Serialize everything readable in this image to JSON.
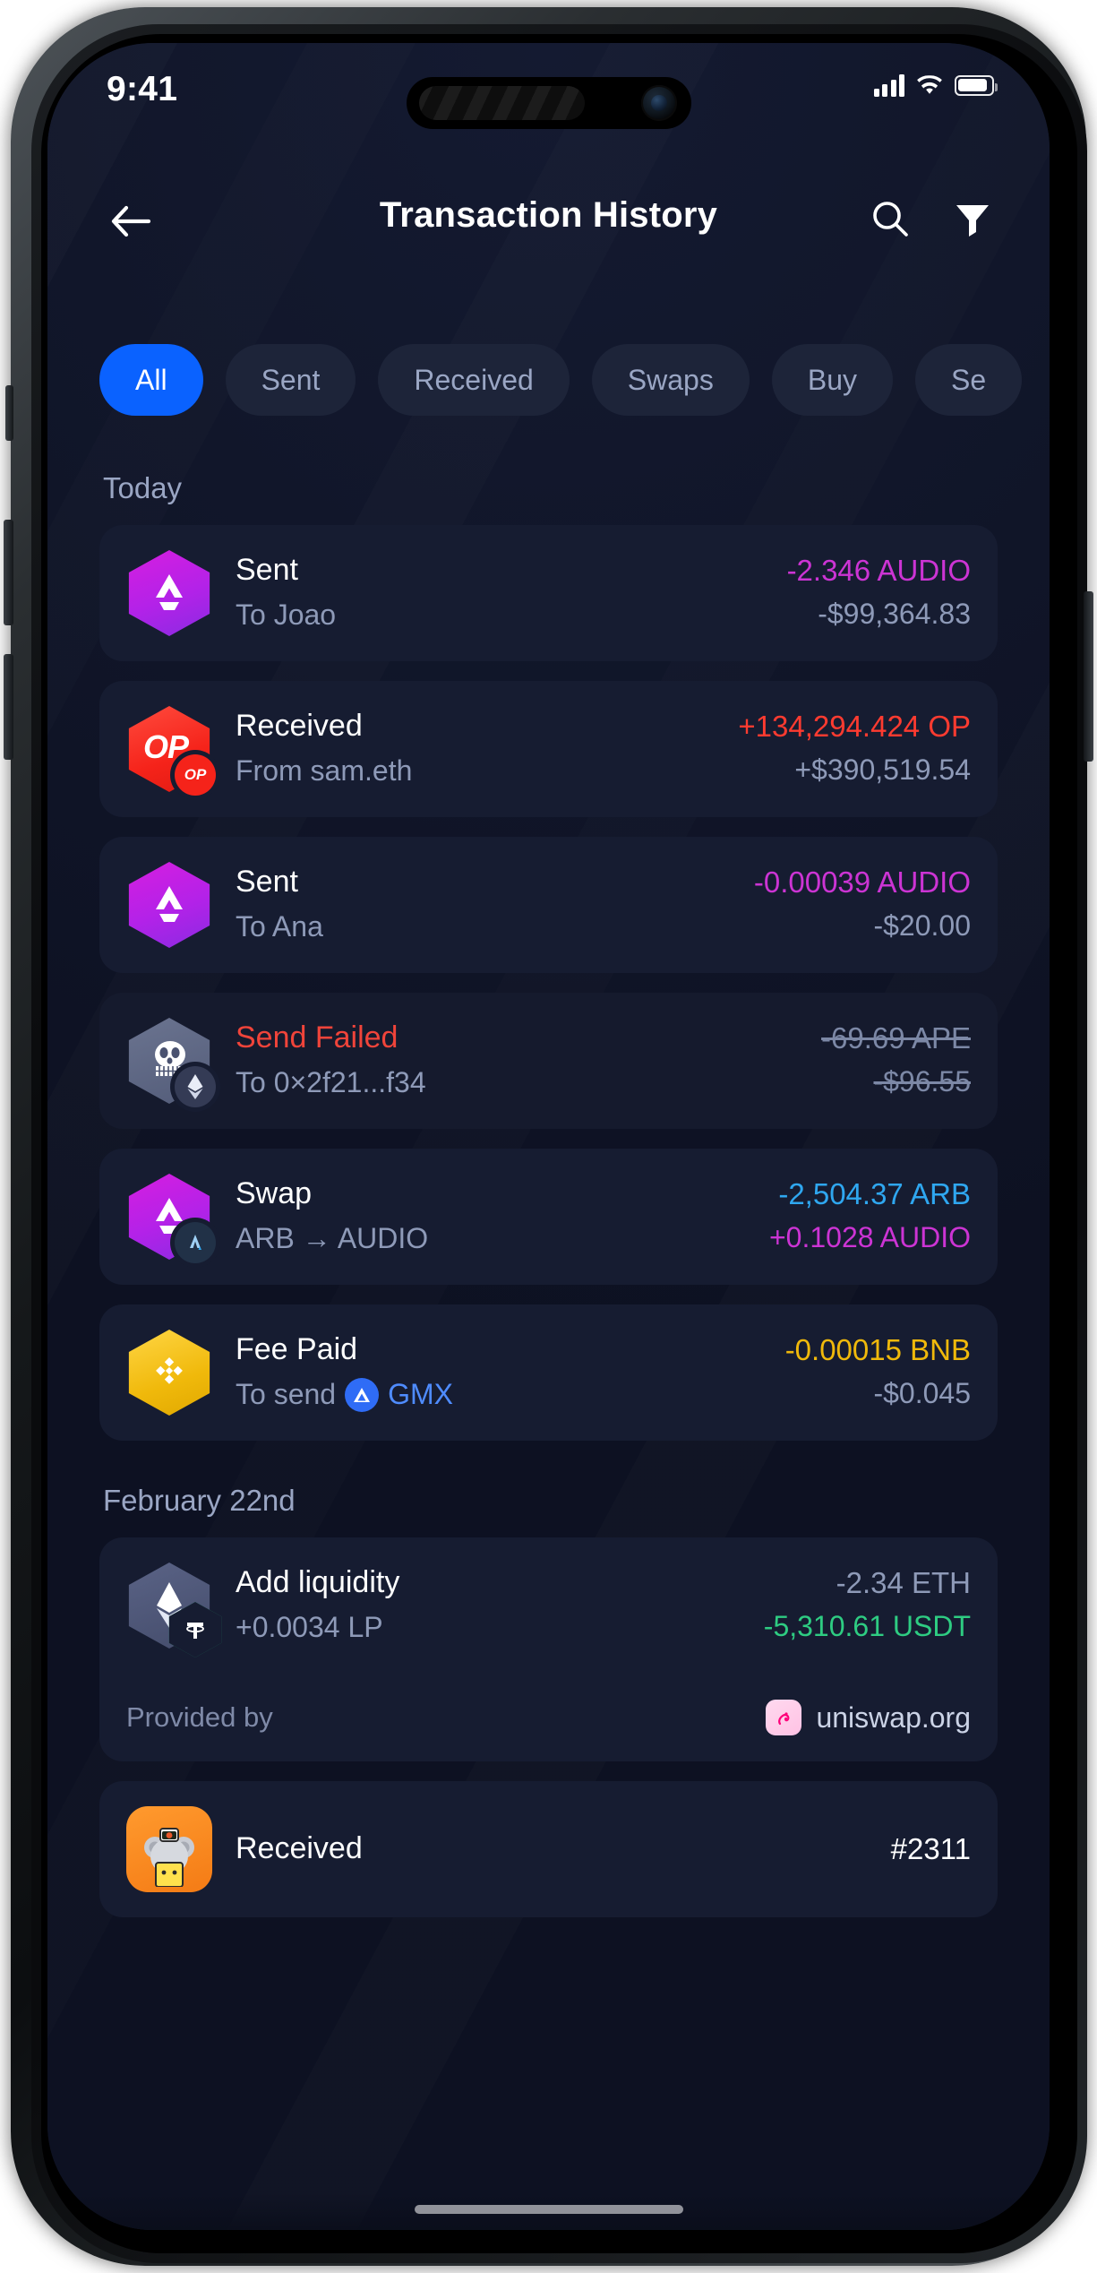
{
  "status_bar": {
    "time": "9:41",
    "icons": [
      "cellular-signal-icon",
      "wifi-icon",
      "battery-icon"
    ]
  },
  "header": {
    "back_icon": "arrow-left-icon",
    "title": "Transaction History",
    "search_icon": "search-icon",
    "filter_icon": "filter-funnel-icon"
  },
  "filters": {
    "active": "All",
    "chips": [
      {
        "label": "All",
        "active": true
      },
      {
        "label": "Sent",
        "active": false
      },
      {
        "label": "Received",
        "active": false
      },
      {
        "label": "Swaps",
        "active": false
      },
      {
        "label": "Buy",
        "active": false
      },
      {
        "label": "Se",
        "active": false
      }
    ]
  },
  "colors": {
    "accent_blue": "#0a62ff",
    "screen_bg": "#101528",
    "card_bg": "#161c31",
    "text_primary": "#ffffff",
    "text_secondary": "#8e9ab8",
    "error_red": "#f0443a",
    "audio_magenta": "#cc34d4",
    "op_red": "#ff3b30",
    "arb_blue": "#2fa7f0",
    "bnb_yellow": "#f0b90b",
    "eth_gray": "#8f9bb8",
    "usdt_green": "#26a17b",
    "link_blue": "#4f8cff"
  },
  "sections": [
    {
      "title": "Today",
      "items": [
        {
          "id": "tx-sent-audio-joao",
          "icon": "audio-token-icon",
          "title": "Sent",
          "title_color": "#ffffff",
          "subtitle": "To Joao",
          "amount": "-2.346 AUDIO",
          "amount_color": "#cc34d4",
          "fiat": "-$99,364.83",
          "fiat_color": "#8e9ab8",
          "failed": false
        },
        {
          "id": "tx-received-op-sam",
          "icon": "optimism-token-icon",
          "badge": "optimism-chain-badge",
          "title": "Received",
          "title_color": "#ffffff",
          "subtitle": "From sam.eth",
          "amount": "+134,294.424 OP",
          "amount_color": "#ff3b30",
          "fiat": "+$390,519.54",
          "fiat_color": "#8e9ab8",
          "failed": false
        },
        {
          "id": "tx-sent-audio-ana",
          "icon": "audio-token-icon",
          "title": "Sent",
          "title_color": "#ffffff",
          "subtitle": "To Ana",
          "amount": "-0.00039 AUDIO",
          "amount_color": "#cc34d4",
          "fiat": "-$20.00",
          "fiat_color": "#8e9ab8",
          "failed": false
        },
        {
          "id": "tx-send-failed-ape",
          "icon": "ape-token-icon",
          "badge": "ethereum-chain-badge",
          "title": "Send Failed",
          "title_color": "#f0443a",
          "subtitle": "To 0×2f21...f34",
          "amount": "-69.69 APE",
          "amount_color": "#7c88a6",
          "fiat": "-$96.55",
          "fiat_color": "#7c88a6",
          "failed": true
        },
        {
          "id": "tx-swap-arb-audio",
          "icon": "audio-token-icon",
          "badge": "arbitrum-chain-badge",
          "title": "Swap",
          "title_color": "#ffffff",
          "subtitle": "ARB → AUDIO",
          "amount": "-2,504.37 ARB",
          "amount_color": "#2fa7f0",
          "fiat": "+0.1028 AUDIO",
          "fiat_color": "#cc34d4",
          "failed": false
        },
        {
          "id": "tx-fee-paid-bnb",
          "icon": "bnb-token-icon",
          "title": "Fee Paid",
          "title_color": "#ffffff",
          "subtitle_prefix": "To send",
          "subtitle_chain_icon": "gmx-token-icon",
          "subtitle_link": "GMX",
          "amount": "-0.00015 BNB",
          "amount_color": "#f0b90b",
          "fiat": "-$0.045",
          "fiat_color": "#8e9ab8",
          "failed": false
        }
      ]
    },
    {
      "title": "February 22nd",
      "items": [
        {
          "id": "tx-add-liquidity-eth-usdt",
          "icon": "ethereum-token-icon",
          "badge": "tether-token-icon",
          "title": "Add liquidity",
          "title_color": "#ffffff",
          "subtitle": "+0.0034 LP",
          "amount": "-2.34 ETH",
          "amount_color": "#8e9ab8",
          "fiat": "-5,310.61 USDT",
          "fiat_color": "#2ecc82",
          "failed": false,
          "provider": {
            "label": "Provided by",
            "logo": "uniswap-logo-icon",
            "name": "uniswap.org"
          }
        },
        {
          "id": "tx-received-nft-2311",
          "icon": "nft-avatar-icon",
          "title": "Received",
          "title_color": "#ffffff",
          "amount": "#2311",
          "amount_color": "#ffffff",
          "failed": false
        }
      ]
    }
  ]
}
